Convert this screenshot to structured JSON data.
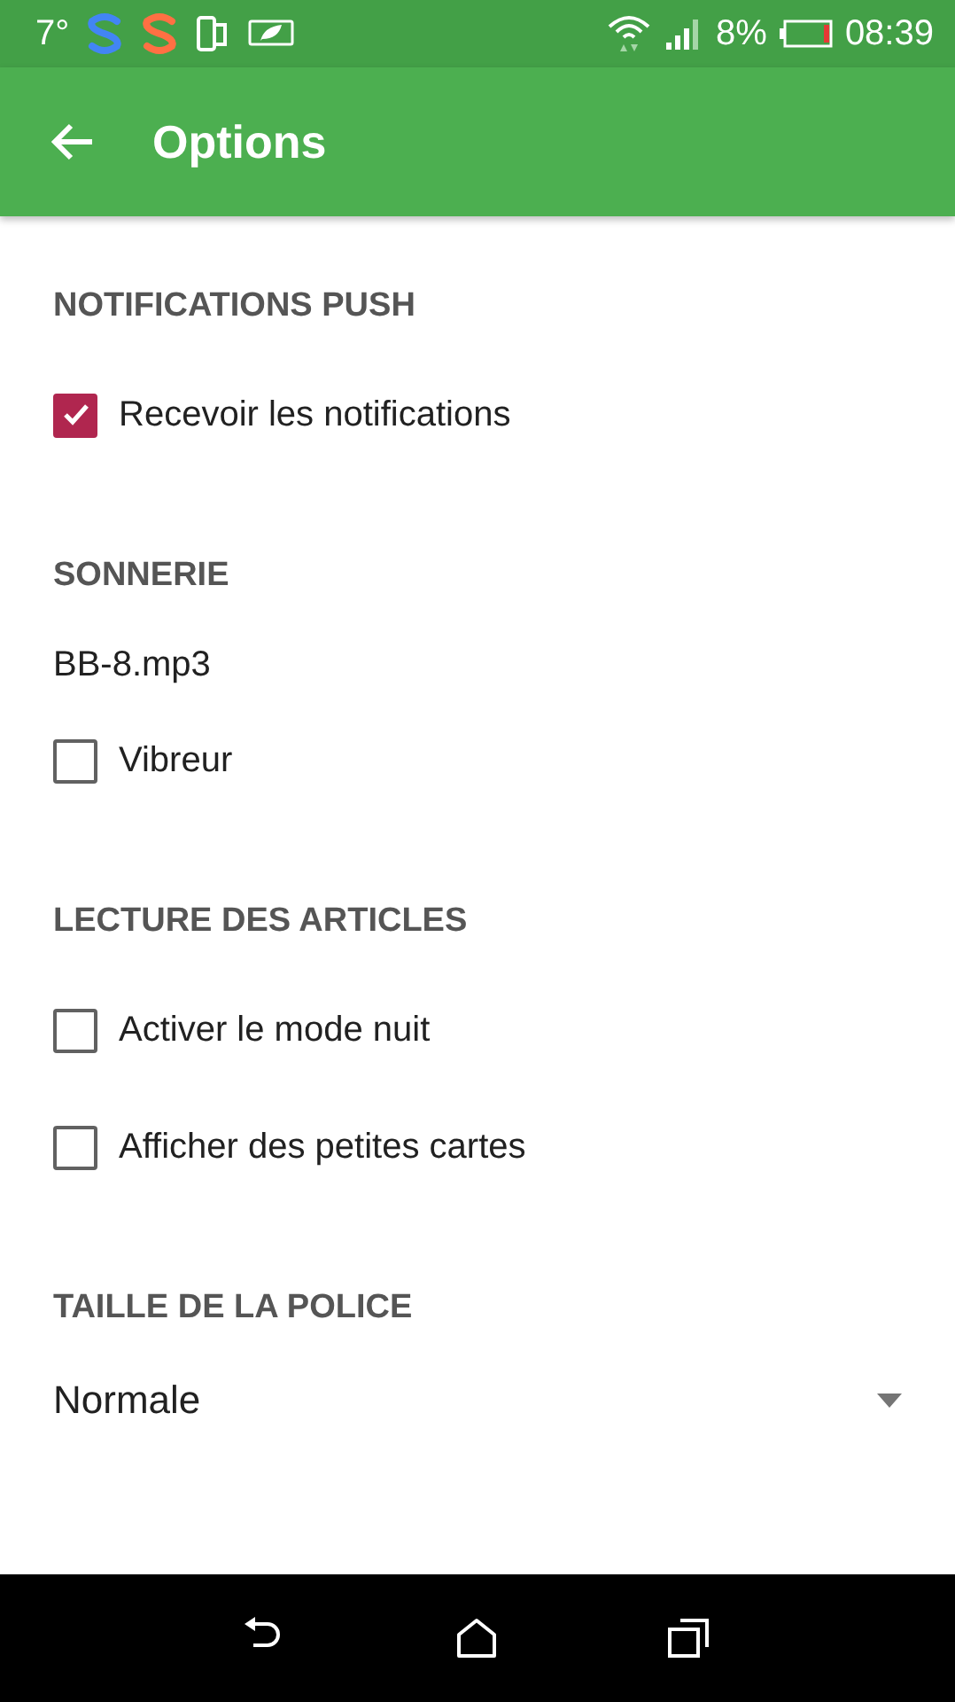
{
  "status_bar": {
    "temperature": "7°",
    "battery_percent": "8%",
    "time": "08:39"
  },
  "app_bar": {
    "title": "Options"
  },
  "sections": [
    {
      "title": "NOTIFICATIONS PUSH",
      "items": [
        {
          "kind": "checkbox",
          "label": "Recevoir les notifications",
          "checked": true
        }
      ]
    },
    {
      "title": "SONNERIE",
      "items": [
        {
          "kind": "text",
          "label": "BB-8.mp3"
        },
        {
          "kind": "checkbox",
          "label": "Vibreur",
          "checked": false
        }
      ]
    },
    {
      "title": "LECTURE DES ARTICLES",
      "items": [
        {
          "kind": "checkbox",
          "label": "Activer le mode nuit",
          "checked": false
        },
        {
          "kind": "checkbox",
          "label": "Afficher des petites cartes",
          "checked": false
        }
      ]
    },
    {
      "title": "TAILLE DE LA POLICE",
      "items": [
        {
          "kind": "dropdown",
          "label": "Normale"
        }
      ]
    }
  ]
}
